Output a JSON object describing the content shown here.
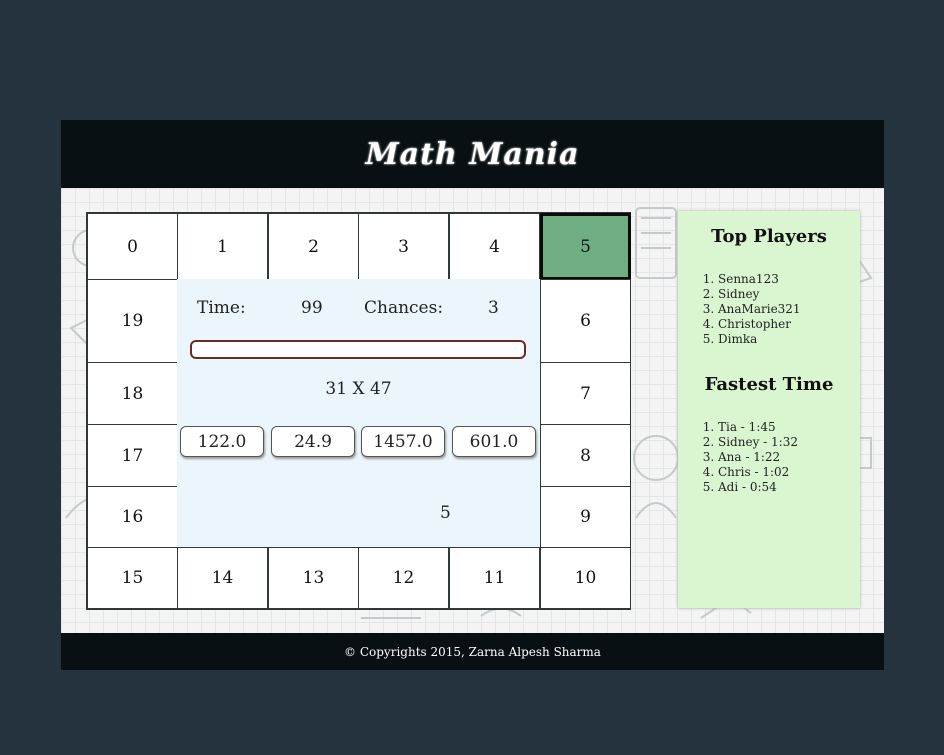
{
  "app": {
    "title": "Math Mania"
  },
  "board": {
    "cells": [
      "0",
      "1",
      "2",
      "3",
      "4",
      "5",
      "6",
      "7",
      "8",
      "9",
      "10",
      "11",
      "12",
      "13",
      "14",
      "15",
      "16",
      "17",
      "18",
      "19"
    ],
    "active_cell": "5"
  },
  "game": {
    "time_label": "Time:",
    "time_value": "99",
    "chances_label": "Chances:",
    "chances_value": "3",
    "progress": 0,
    "question": "31 X 47",
    "answers": [
      "122.0",
      "24.9",
      "1457.0",
      "601.0"
    ],
    "dice_value": "5"
  },
  "sidebar": {
    "top_players_title": "Top Players",
    "top_players": [
      "Senna123",
      "Sidney",
      "AnaMarie321",
      "Christopher",
      "Dimka"
    ],
    "fastest_title": "Fastest Time",
    "fastest_times": [
      "Tia - 1:45",
      "Sidney - 1:32",
      "Ana - 1:22",
      "Chris - 1:02",
      "Adi - 0:54"
    ]
  },
  "footer": {
    "copyright": "© Copyrights 2015, Zarna Alpesh Sharma"
  },
  "colors": {
    "active_cell": "#6fae83",
    "sidebar_bg": "#d9f6d1",
    "center_bg": "#eaf6fb",
    "header_bg": "#081013"
  }
}
